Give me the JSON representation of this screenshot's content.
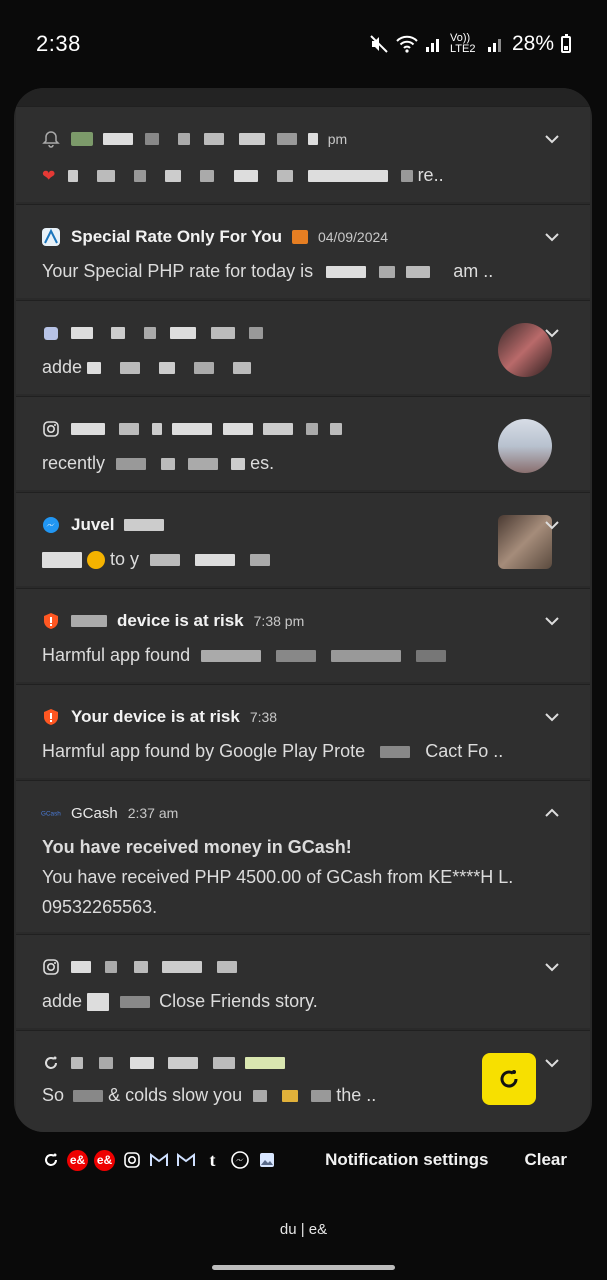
{
  "status_bar": {
    "time": "2:38",
    "network_label": "Vo)) LTE2",
    "battery_percent": "28%"
  },
  "notifications": [
    {
      "id": "n1",
      "icon": "bell-icon",
      "time": "pm",
      "body_suffix": "re.."
    },
    {
      "id": "n2",
      "icon": "airline-icon",
      "title": "Special Rate Only For You",
      "time": "04/09/2024",
      "body_prefix": "Your Special PHP rate for today is",
      "body_suffix": "am .."
    },
    {
      "id": "n3",
      "icon": "app-icon",
      "body_prefix": "adde"
    },
    {
      "id": "n4",
      "icon": "instagram-icon",
      "body_prefix": "recently",
      "body_suffix": "es."
    },
    {
      "id": "n5",
      "icon": "messenger-icon",
      "title": "Juvel",
      "body_mid": "to y"
    },
    {
      "id": "n6",
      "icon": "shield-icon",
      "title": "device is at risk",
      "time": "7:38 pm",
      "body_prefix": "Harmful app found"
    },
    {
      "id": "n7",
      "icon": "shield-icon",
      "title": "Your device is at risk",
      "time": "7:38",
      "body_prefix": "Harmful app found by Google Play Prote",
      "body_suffix": "Cact Fo .."
    },
    {
      "id": "n8",
      "icon": "gcash-icon",
      "app": "GCash",
      "time": "2:37 am",
      "title": "You have received money in GCash!",
      "body_line1": "You have received PHP 4500.00 of GCash from KE****H L.",
      "body_line2": "09532265563."
    },
    {
      "id": "n9",
      "icon": "instagram-icon",
      "body_prefix": "adde",
      "body_suffix": "Close Friends story."
    },
    {
      "id": "n10",
      "icon": "refresh-app-icon",
      "body_prefix": "So",
      "body_mid": "& colds slow you",
      "body_suffix": "the .."
    }
  ],
  "bottom_bar": {
    "apps": [
      "refresh-app-icon",
      "e-and-icon",
      "e-and-icon",
      "instagram-icon",
      "gmail-icon",
      "gmail-icon",
      "tumblr-icon",
      "messenger-icon",
      "gallery-icon"
    ],
    "e_and_label": "e&",
    "notification_settings": "Notification settings",
    "clear": "Clear"
  },
  "carrier": "du | e&",
  "colors": {
    "panel": "#2a2a2a",
    "card": "#2f2f2f",
    "shield": "#ff5722",
    "messenger": "#2196f3",
    "yellow_app": "#f7e000"
  }
}
